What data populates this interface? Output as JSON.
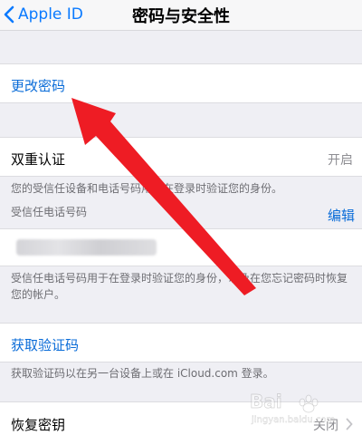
{
  "nav": {
    "back_label": "Apple ID",
    "title": "密码与安全性"
  },
  "change_password": {
    "label": "更改密码"
  },
  "two_factor": {
    "label": "双重认证",
    "value": "开启",
    "note": "您的受信任设备和电话号码用于在登录时验证您的身份。",
    "trusted_phone_label": "受信任电话号码",
    "edit_label": "编辑",
    "phone_note": "受信任电话号码用于在登录时验证您的身份，以及在您忘记密码时恢复您的帐户。"
  },
  "get_code": {
    "label": "获取验证码",
    "note": "获取验证码以在另一台设备上或在 iCloud.com 登录。"
  },
  "recovery_key": {
    "label": "恢复密钥",
    "value": "关闭"
  },
  "watermark": {
    "brand": "Bai",
    "site": "jingyan.baidu.com"
  },
  "colors": {
    "accent": "#0a7aff",
    "link": "#0a6cd8",
    "annotation": "#ee1c24"
  },
  "icons": {
    "back": "chevron-left-icon",
    "chevron": "chevron-right-icon",
    "annotation": "red-arrow-icon"
  }
}
